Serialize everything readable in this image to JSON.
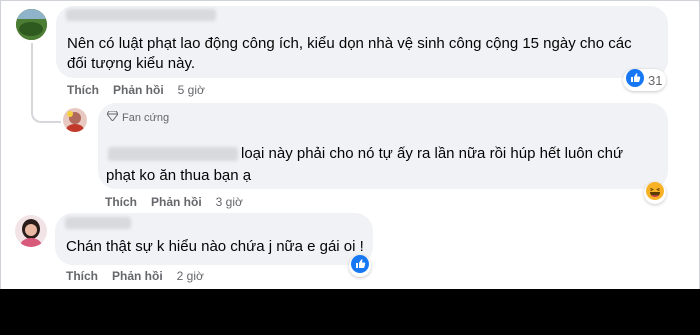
{
  "comments": [
    {
      "author": "Đặp Tuyết Yến Mai",
      "text_lines": [
        "Nên có luật phạt lao động công ích, kiểu dọn nhà vệ sinh công cộng 15 ngày cho các",
        "đối tượng kiểu này."
      ],
      "actions": {
        "like": "Thích",
        "reply": "Phản hồi",
        "time": "5 giờ"
      },
      "reaction": {
        "icon": "like-icon",
        "count": "31"
      }
    },
    {
      "badge": "Fan cứng",
      "text_lines": [
        "loại này phải cho nó tự ấy ra lần nữa rồi húp hết luôn chứ",
        "phạt ko ăn thua bạn ạ"
      ],
      "actions": {
        "like": "Thích",
        "reply": "Phản hồi",
        "time": "3 giờ"
      },
      "reaction": {
        "icon": "haha-icon"
      }
    },
    {
      "text_lines": [
        "Chán thật sự k hiểu nào chứa j nữa e gái oi !"
      ],
      "actions": {
        "like": "Thích",
        "reply": "Phản hồi",
        "time": "2 giờ"
      },
      "reaction": {
        "icon": "like-icon"
      }
    }
  ],
  "colors": {
    "bubble": "#f0f2f5",
    "like_blue": "#1877f2",
    "haha_yellow": "#f7b125",
    "action_gray": "#65676b"
  }
}
